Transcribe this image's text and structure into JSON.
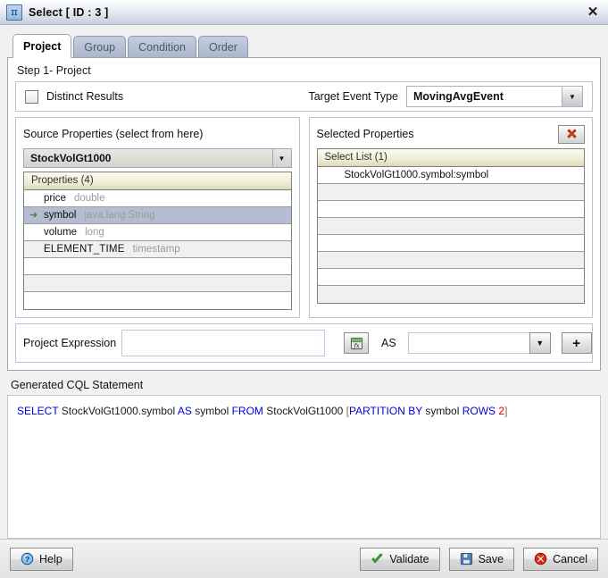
{
  "window": {
    "title": "Select [ ID : 3 ]",
    "icon": "projection-pi-icon",
    "close_label": "✕"
  },
  "tabs": [
    {
      "label": "Project",
      "active": true
    },
    {
      "label": "Group",
      "active": false
    },
    {
      "label": "Condition",
      "active": false
    },
    {
      "label": "Order",
      "active": false
    }
  ],
  "step": {
    "label": "Step 1- Project"
  },
  "options": {
    "distinct_label": "Distinct Results",
    "distinct_checked": false,
    "target_event_type_label": "Target Event Type",
    "target_event_type_value": "MovingAvgEvent",
    "dropdown_glyph": "▼"
  },
  "source_panel": {
    "title": "Source Properties (select from here)",
    "stream_value": "StockVolGt1000",
    "list_header": "Properties (4)",
    "marker_glyph": "➜",
    "rows": [
      {
        "name": "price",
        "type": "double",
        "selected": false,
        "marker": false
      },
      {
        "name": "symbol",
        "type": "java.lang.String",
        "selected": true,
        "marker": true
      },
      {
        "name": "volume",
        "type": "long",
        "selected": false,
        "marker": false
      },
      {
        "name": "ELEMENT_TIME",
        "type": "timestamp",
        "selected": false,
        "marker": false
      },
      {
        "name": "",
        "type": "",
        "selected": false,
        "marker": false
      },
      {
        "name": "",
        "type": "",
        "selected": false,
        "marker": false
      },
      {
        "name": "",
        "type": "",
        "selected": false,
        "marker": false
      }
    ]
  },
  "selected_panel": {
    "title": "Selected Properties",
    "delete_icon": "red-x-delete-icon",
    "list_header": "Select List (1)",
    "rows": [
      {
        "label": "StockVolGt1000.symbol:symbol"
      },
      {
        "label": ""
      },
      {
        "label": ""
      },
      {
        "label": ""
      },
      {
        "label": ""
      },
      {
        "label": ""
      },
      {
        "label": ""
      },
      {
        "label": ""
      }
    ]
  },
  "expression": {
    "label": "Project Expression",
    "value": "",
    "placeholder": "",
    "fx_icon": "function-builder-icon",
    "as_label": "AS",
    "alias_value": "",
    "alias_placeholder": "",
    "dropdown_glyph": "▼",
    "add_label": "+"
  },
  "cql": {
    "label": "Generated CQL Statement",
    "tokens": [
      {
        "text": "SELECT",
        "kind": "kw"
      },
      {
        "text": " StockVolGt1000.symbol ",
        "kind": "ident"
      },
      {
        "text": "AS",
        "kind": "kw"
      },
      {
        "text": " symbol ",
        "kind": "ident"
      },
      {
        "text": "FROM",
        "kind": "kw"
      },
      {
        "text": " StockVolGt1000  ",
        "kind": "ident"
      },
      {
        "text": "[",
        "kind": "brk"
      },
      {
        "text": "PARTITION BY",
        "kind": "kw"
      },
      {
        "text": " symbol  ",
        "kind": "ident"
      },
      {
        "text": "ROWS",
        "kind": "kw"
      },
      {
        "text": " ",
        "kind": "ident"
      },
      {
        "text": "2",
        "kind": "num"
      },
      {
        "text": "]",
        "kind": "brk"
      }
    ],
    "plain": "SELECT StockVolGt1000.symbol AS symbol FROM StockVolGt1000  [PARTITION BY symbol  ROWS 2]"
  },
  "footer": {
    "help": "Help",
    "validate": "Validate",
    "save": "Save",
    "cancel": "Cancel"
  }
}
